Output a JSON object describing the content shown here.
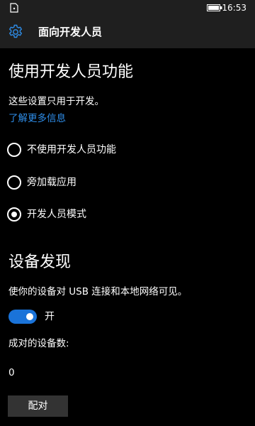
{
  "status_bar": {
    "time": "16:53",
    "icons": [
      "sim-card-icon",
      "battery-icon"
    ]
  },
  "header": {
    "title": "面向开发人员",
    "icon": "gear-icon",
    "accent": "#2e8de8"
  },
  "developer_features": {
    "heading": "使用开发人员功能",
    "description": "这些设置只用于开发。",
    "learn_more": "了解更多信息",
    "link_color": "#2e8de8",
    "options": [
      {
        "label": "不使用开发人员功能",
        "selected": false
      },
      {
        "label": "旁加载应用",
        "selected": false
      },
      {
        "label": "开发人员模式",
        "selected": true
      }
    ]
  },
  "device_discovery": {
    "heading": "设备发现",
    "description": "使你的设备对 USB 连接和本地网络可见。",
    "toggle": {
      "on": true,
      "label": "开",
      "color": "#1a73d9"
    },
    "paired_label": "成对的设备数:",
    "paired_count": "0",
    "pair_button": "配对"
  }
}
